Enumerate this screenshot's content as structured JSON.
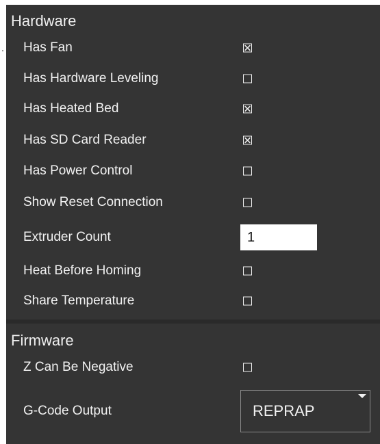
{
  "hardware": {
    "title": "Hardware",
    "rows": [
      {
        "label": "Has Fan",
        "type": "checkbox",
        "checked": true
      },
      {
        "label": "Has Hardware Leveling",
        "type": "checkbox",
        "checked": false
      },
      {
        "label": "Has Heated Bed",
        "type": "checkbox",
        "checked": true
      },
      {
        "label": "Has SD Card Reader",
        "type": "checkbox",
        "checked": true
      },
      {
        "label": "Has Power Control",
        "type": "checkbox",
        "checked": false
      },
      {
        "label": "Show Reset Connection",
        "type": "checkbox",
        "checked": false
      },
      {
        "label": "Extruder Count",
        "type": "number",
        "value": "1"
      },
      {
        "label": "Heat Before Homing",
        "type": "checkbox",
        "checked": false
      },
      {
        "label": "Share Temperature",
        "type": "checkbox",
        "checked": false
      }
    ]
  },
  "firmware": {
    "title": "Firmware",
    "rows": [
      {
        "label": "Z Can Be Negative",
        "type": "checkbox",
        "checked": false
      },
      {
        "label": "G-Code Output",
        "type": "select",
        "value": "REPRAP"
      }
    ]
  },
  "icons": {
    "checkbox_checked": "checkbox-checked-icon",
    "checkbox_unchecked": "checkbox-unchecked-icon",
    "dropdown": "chevron-down-icon"
  },
  "colors": {
    "panel_background": "#343434",
    "text": "#f2f2f2",
    "input_background": "#ffffff"
  }
}
